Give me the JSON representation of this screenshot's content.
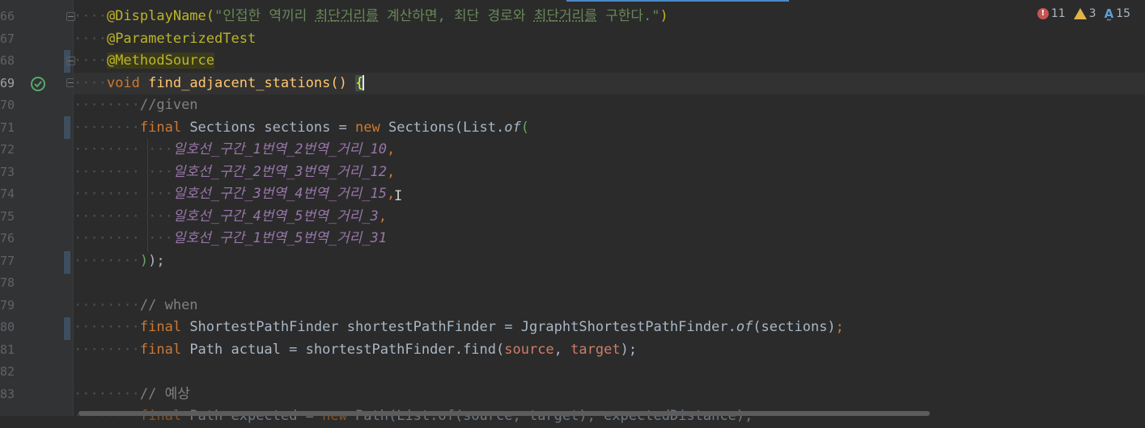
{
  "inspections": {
    "errors": "11",
    "warnings": "3",
    "typos": "15"
  },
  "lines": [
    {
      "num": "66"
    },
    {
      "num": "67"
    },
    {
      "num": "68"
    },
    {
      "num": "69"
    },
    {
      "num": "70"
    },
    {
      "num": "71"
    },
    {
      "num": "72"
    },
    {
      "num": "73"
    },
    {
      "num": "74"
    },
    {
      "num": "75"
    },
    {
      "num": "76"
    },
    {
      "num": "77"
    },
    {
      "num": "78"
    },
    {
      "num": "79"
    },
    {
      "num": "80"
    },
    {
      "num": "81"
    },
    {
      "num": "82"
    },
    {
      "num": "83"
    }
  ],
  "code": {
    "l66_ann": "@DisplayName(",
    "l66_str1": "\"인접한 역끼리 ",
    "l66_str2": "최단거리를",
    "l66_str3": " 계산하면, 최단 경로와 ",
    "l66_str4": "최단거리를",
    "l66_str5": " 구한다.\"",
    "l66_close": ")",
    "l67": "@ParameterizedTest",
    "l68": "@MethodSource",
    "l69_kw": "void",
    "l69_fn": "find_adjacent_stations",
    "l69_paren": "()",
    "l69_brace": "{",
    "l70": "//given",
    "l71_kw": "final",
    "l71_type": " Sections sections = ",
    "l71_new": "new",
    "l71_call": " Sections(List.",
    "l71_of": "of",
    "l71_open": "(",
    "l72": "일호선_구간_1번역_2번역_거리_10",
    "l73": "일호선_구간_2번역_3번역_거리_12",
    "l74": "일호선_구간_3번역_4번역_거리_15",
    "l75": "일호선_구간_4번역_5번역_거리_3",
    "l76": "일호선_구간_1번역_5번역_거리_31",
    "comma": ",",
    "l77_close": ")",
    "l77_rest": ");",
    "l79": "// when",
    "l80_kw": "final",
    "l80_mid": " ShortestPathFinder shortestPathFinder = JgraphtShortestPathFinder.",
    "l80_of": "of",
    "l80_args": "(sections)",
    "l80_end": ";",
    "l81_kw": "final",
    "l81_mid": " Path actual = shortestPathFinder.find(",
    "l81_source": "source",
    "l81_sep": ", ",
    "l81_target": "target",
    "l81_end": ");",
    "l83": "// 예상",
    "l84_kw": "final",
    "l84_mid": " Path expected = ",
    "l84_new": "new",
    "l84_rest": " Path(List.of(source, target), expectedDistance);"
  }
}
